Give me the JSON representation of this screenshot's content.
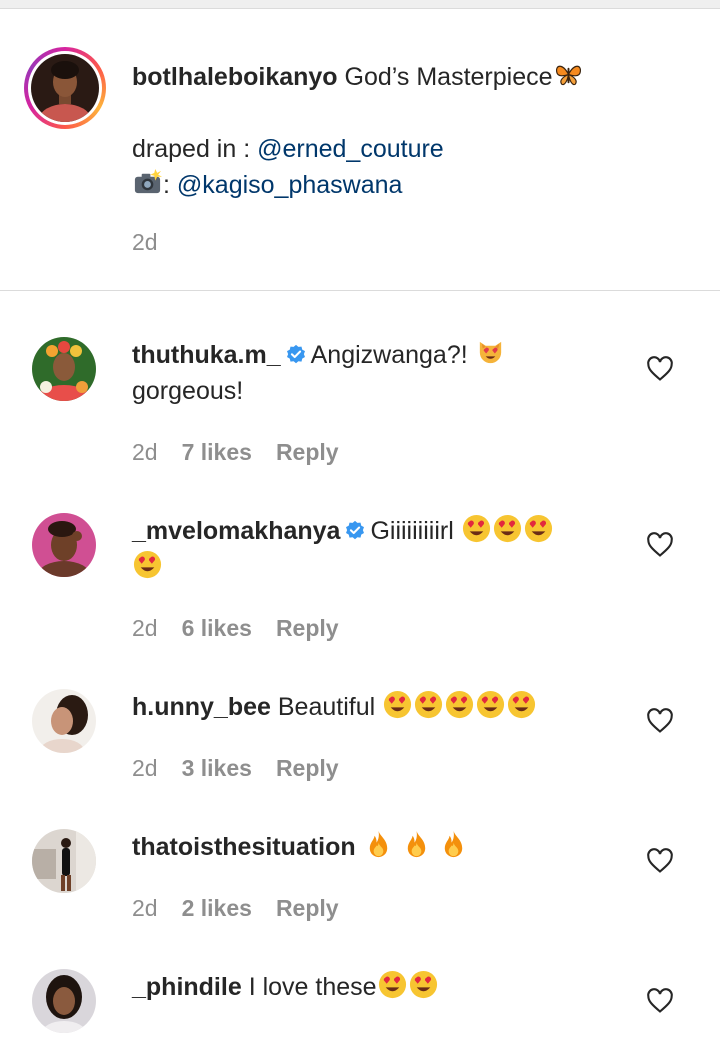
{
  "caption": {
    "username": "botlhaleboikanyo",
    "text": "God’s Masterpiece",
    "line2_prefix": "draped in : ",
    "line2_mention": "@erned_couture",
    "line3_prefix": ": ",
    "line3_mention": "@kagiso_phaswana",
    "time": "2d"
  },
  "comments": [
    {
      "username": "thuthuka.m_",
      "verified": true,
      "text_a": "Angizwanga?!",
      "text_b": "gorgeous!",
      "time": "2d",
      "likes": "7 likes",
      "reply": "Reply"
    },
    {
      "username": "_mvelomakhanya",
      "verified": true,
      "text_a": "Giiiiiiiiirl",
      "time": "2d",
      "likes": "6 likes",
      "reply": "Reply"
    },
    {
      "username": "h.unny_bee",
      "verified": false,
      "text_a": "Beautiful",
      "time": "2d",
      "likes": "3 likes",
      "reply": "Reply"
    },
    {
      "username": "thatoisthesituation",
      "verified": false,
      "text_a": "",
      "time": "2d",
      "likes": "2 likes",
      "reply": "Reply"
    },
    {
      "username": "_phindile",
      "verified": false,
      "text_a": "I love these",
      "time": "",
      "likes": "",
      "reply": ""
    }
  ],
  "icons": {
    "verified": "verified-badge-icon",
    "like": "heart-outline-icon",
    "butterfly": "butterfly-emoji",
    "camera": "camera-flash-emoji",
    "heart_eyes": "heart-eyes-emoji",
    "heart_eyes_cat": "heart-eyes-cat-emoji",
    "fire": "fire-emoji"
  },
  "colors": {
    "text": "#262626",
    "mention": "#00376b",
    "meta": "#8e8e8e",
    "verified": "#3897f0",
    "divider": "#dbdbdb"
  }
}
